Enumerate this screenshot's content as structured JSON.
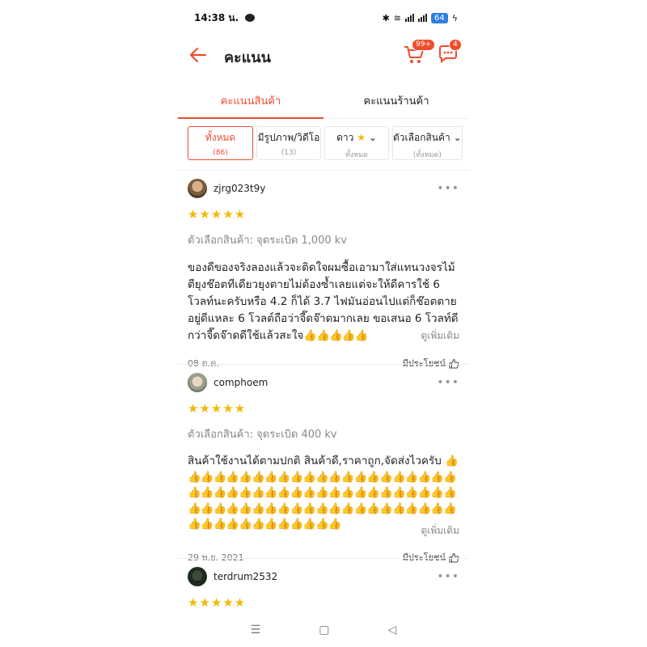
{
  "status": {
    "time": "14:38 น.",
    "battery": "64"
  },
  "header": {
    "title": "คะแนน",
    "cart_badge": "99+",
    "chat_badge": "4"
  },
  "tabs": [
    {
      "label": "คะแนนสินค้า",
      "active": true
    },
    {
      "label": "คะแนนร้านค้า",
      "active": false
    }
  ],
  "filters": [
    {
      "label": "ทั้งหมด",
      "count": "(86)",
      "active": true
    },
    {
      "label": "มีรูปภาพ/วิดีโอ",
      "count": "(13)"
    },
    {
      "label": "ดาว",
      "count": "ทั้งหมด"
    },
    {
      "label": "ตัวเลือกสินค้า",
      "count": "(ทั้งหมด)"
    }
  ],
  "reviews": [
    {
      "username": "zjrg023t9y",
      "rating": 5,
      "variant": "ตัวเลือกสินค้า: จุดระเบิด 1,000 kv",
      "body_text": "ของดีของจริงลองแล้วจะติดใจผมซื้อเอามาใส่แทนวงจรไม้ตียุงช๊อตทีเดียวยุงตายไม่ต้องซ้ำเลยแต่จะให้ดีคารใช้ 6 โวลท์นะครับหรือ 4.2 ก็ได้ 3.7 ไฟมันอ่อนไปแต่ก็ช๊อตตายอยู่ดีแหละ 6 โวลต์ถือว่าจี๊ดจ๊าดมากเลย ขอเสนอ 6 โวลท์ดีกว่าจี๊ดจ๊าดดีใช้แล้วสะใจ",
      "body_emoji": "👍👍👍👍👍",
      "more": "ดูเพิ่มเติม",
      "date": "08 ต.ค.",
      "helpful": "มีประโยชน์"
    },
    {
      "username": "comphoem",
      "rating": 5,
      "variant": "ตัวเลือกสินค้า: จุดระเบิด 400 kv",
      "body_text": "สินค้าใช้งานได้ตามปกติ สินค้าดี,ราคาถูก,จัดส่งไวครับ",
      "body_emoji": "👍👍👍👍👍👍👍👍👍👍👍👍👍👍👍👍👍👍👍👍👍👍👍👍👍👍👍👍👍👍👍👍👍👍👍👍👍👍👍👍👍👍👍👍👍👍👍👍👍👍👍👍👍👍👍👍👍👍👍👍👍👍👍👍👍👍👍👍👍👍👍👍👍👍👍👍",
      "more": "ดูเพิ่มเติม",
      "date": "29 พ.ย. 2021",
      "helpful": "มีประโยชน์"
    },
    {
      "username": "terdrum2532",
      "rating": 5
    }
  ],
  "review_stars": "★★★★★",
  "colors": {
    "accent": "#ee4d2d",
    "star": "#f5b800"
  }
}
